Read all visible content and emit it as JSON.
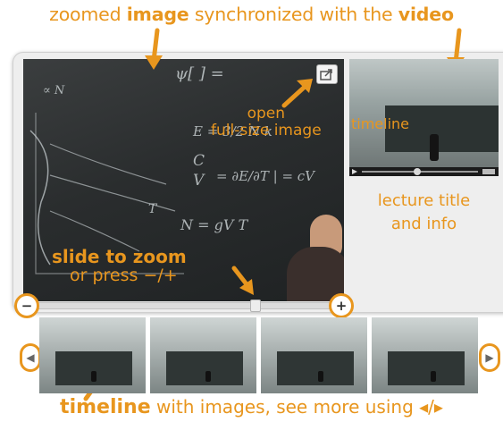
{
  "captions": {
    "top_parts": [
      "zoomed ",
      "image",
      " synchronized with the ",
      "video"
    ],
    "open_line1": "open",
    "open_line2": "full-size image",
    "slide_line1": "slide to zoom",
    "slide_line2": "or press −/+",
    "timeline_video": "timeline",
    "lecture_line1": "lecture title",
    "lecture_line2": "and info",
    "bottom_strong": "timeline",
    "bottom_rest": " with images, see more using ◂/▸"
  },
  "board_text": {
    "t1": "∝ N",
    "t2": "ψ[ ] = ",
    "t3": "E = 3/2 N k",
    "t4": "C",
    "t5": "V",
    "t6": "= ∂E/∂T | = cV",
    "t7": "N = gV T",
    "t8": "T"
  },
  "controls": {
    "zoom_out_symbol": "−",
    "zoom_in_symbol": "+",
    "prev_symbol": "◀",
    "next_symbol": "▶"
  },
  "zoom": {
    "level_fraction": 0.8
  },
  "colors": {
    "accent": "#e8961e",
    "frame": "#eeeeee"
  },
  "icons": {
    "share": "share-icon"
  }
}
